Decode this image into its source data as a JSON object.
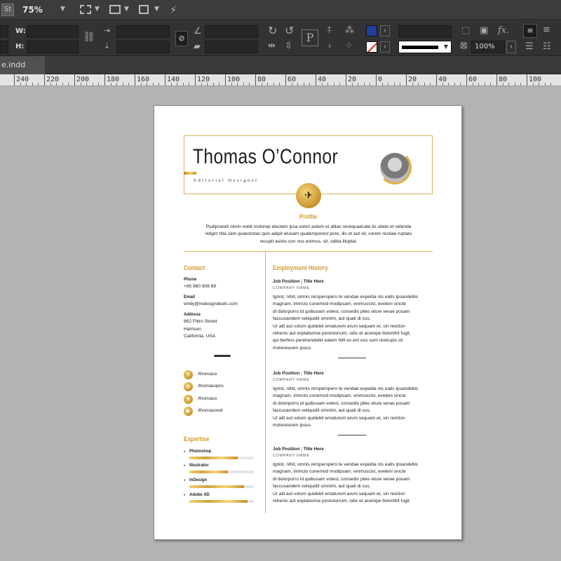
{
  "app": {
    "logo": "St",
    "zoom": "75%",
    "icons": [
      "screen-mode-icon",
      "view-options-icon",
      "arrange-icon",
      "gpu-icon"
    ]
  },
  "control": {
    "w_label": "W:",
    "h_label": "H:",
    "stroke_percent": "100%",
    "icons": [
      "constrain-icon",
      "rotate-cw-icon",
      "rotate-ccw-icon",
      "flip-h-icon",
      "flip-v-icon",
      "paragraph-icon",
      "align-icon",
      "fx-icon"
    ]
  },
  "document_tab": "e.indd",
  "ruler": {
    "labels": [
      "240",
      "220",
      "200",
      "180",
      "160",
      "140",
      "120",
      "100",
      "80",
      "60",
      "40",
      "20",
      "0",
      "20",
      "40",
      "60",
      "80",
      "100"
    ]
  },
  "resume": {
    "name": "Thomas O’Connor",
    "job_title": "Editorial Designer",
    "profile_heading": "Profile",
    "profile_text": [
      "Pudipsandi nimin nobit molorep electem ipsa volori autem et alitas resequaecate lis ullate et velende",
      "ndignt hita sam quaestotas quis adipit etusam quatemporest pore, ilis et aut vit, corem restiae ruptatu",
      "recupit asinis con nos enimus, sit, oditia illuptat."
    ],
    "contact_heading": "Contact",
    "contact": {
      "phone_label": "Phone",
      "phone": "+65 980 909 89",
      "email_label": "Email",
      "email": "emily@indesigndeals.com",
      "address_label": "Address",
      "address_lines": [
        "862  Fittro Street",
        "Harrison",
        "California, USA"
      ]
    },
    "social": [
      {
        "icon": "facebook-icon",
        "handle": "/thomaso"
      },
      {
        "icon": "instagram-icon",
        "handle": "/thomasopro"
      },
      {
        "icon": "twitter-icon",
        "handle": "/thomaso"
      },
      {
        "icon": "youtube-icon",
        "handle": "/thomasovid"
      }
    ],
    "expertise_heading": "Expertise",
    "skills": [
      {
        "name": "Photoshop",
        "level": 0.75
      },
      {
        "name": "Illustrator",
        "level": 0.6
      },
      {
        "name": "InDesign",
        "level": 0.85
      },
      {
        "name": "Adobe XD",
        "level": 0.9
      }
    ],
    "employment_heading": "Employment History",
    "jobs": [
      {
        "position": "Job Position",
        "title": "Title Here",
        "company": "Company Name",
        "lines": [
          "Ignist, nihit, omnis rersperspero te vendae expedia nis eatis ipsandebis",
          "magnam, imincto conemod modipsam, enimuscist, eveleni sincte",
          "di dolorporro id quibusam volest, consedis plies eture verae posam",
          "faccusandem veliquidit omnimi, aut quati di cus.",
          "Ur alit aut volum quidebit ematurem arum sequam et, sin reiction",
          "rehenis aut explaborise porestorrum, odis et acerepe llorenihit fugit,",
          "qui berfers perehendebit eatem hilit ex ent eos sum restrupis sit",
          "moloreiurem ipsus."
        ]
      },
      {
        "position": "Job Position",
        "title": "Title Here",
        "company": "Company Name",
        "lines": [
          "Ignist, nihit, omnis rersperspero te vendae expedia nis eatis ipsandebis",
          "magnam, imincto conemod modipsam, enimuscist, eveleni sincte",
          "di dolorporro id quibusam volest, consedis plies eture verae posam",
          "faccusandem veliquidit omnimi, aut quati di cus.",
          "Ur alit aut volum quidebit ematurem arum sequam et, sin reiction",
          "moloreiurem ipsus."
        ]
      },
      {
        "position": "Job Position",
        "title": "Title Here",
        "company": "Company Name",
        "lines": [
          "Ignist, nihit, omnis rersperspero te vendae expedia nis eatis ipsandebis",
          "magnam, imincto conemod modipsam, enimuscist, eveleni sincte",
          "di dolorporro id quibusam volest, consedis plies eture verae posam",
          "faccusandem veliquidit omnimi, aut quati di cus.",
          "Ur alit aut volum quidebit ematurem arum sequam et, sin reiction",
          "rehenis aut explaborise porestorrum, odis et acerepe llorenihit fugit"
        ]
      }
    ]
  },
  "colors": {
    "accent_gold": "#c99a2e",
    "fill_swatch": "#1f3e9c",
    "app_bg": "#323232",
    "pasteboard": "#b3b3b3"
  }
}
